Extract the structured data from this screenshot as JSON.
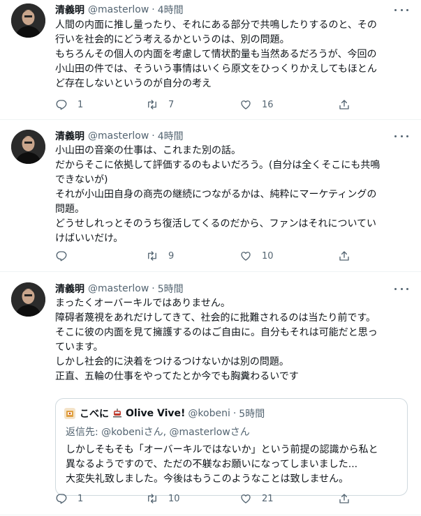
{
  "tweets": [
    {
      "name": "清義明",
      "handle": "@masterlow",
      "dot": "·",
      "time": "4時間",
      "lines": [
        "人間の内面に推し量ったり、それにある部分で共鳴したりするのと、その",
        "行いを社会的にどう考えるかというのは、別の問題。",
        "もちろんその個人の内面を考慮して情状酌量も当然あるだろうが、今回の",
        "小山田の件では、そういう事情はいくら原文をひっくりかえしてもほとん",
        "ど存在しないというのが自分の考え"
      ],
      "replies": "1",
      "retweets": "7",
      "likes": "16"
    },
    {
      "name": "清義明",
      "handle": "@masterlow",
      "dot": "·",
      "time": "4時間",
      "lines": [
        "小山田の音楽の仕事は、これまた別の話。",
        "だからそこに依拠して評価するのもよいだろう。(自分は全くそこにも共鳴",
        "できないが)",
        "それが小山田自身の商売の継続につながるかは、純粋にマーケティングの",
        "問題。",
        "どうせしれっとそのうち復活してくるのだから、ファンはそれについてい",
        "けばいいだけ。"
      ],
      "replies": "",
      "retweets": "9",
      "likes": "10"
    },
    {
      "name": "清義明",
      "handle": "@masterlow",
      "dot": "·",
      "time": "5時間",
      "lines": [
        "まったくオーバーキルではありません。",
        "障碍者蔑視をあれだけしてきて、社会的に批難されるのは当たり前です。",
        "そこに彼の内面を見て擁護するのはご自由に。自分もそれは可能だと思っ",
        "ています。",
        "しかし社会的に決着をつけるつけないかは別の問題。",
        "正直、五輪の仕事をやってたとか今でも胸糞わるいです"
      ],
      "replies": "1",
      "retweets": "10",
      "likes": "21",
      "quote": {
        "name": "こべに",
        "name_suffix": "Olive Vive!",
        "handle": "@kobeni",
        "dot": "·",
        "time": "5時間",
        "reply_to": "返信先: @kobeniさん, @masterlowさん",
        "lines": [
          "しかしそもそも「オーバーキルではないか」という前提の認識から私と",
          "異なるようですので、ただの不躾なお願いになってしまいました...",
          "大変失礼致しました。今後はもうこのようなことは致しません。"
        ]
      }
    }
  ],
  "icons": [
    "reply-icon",
    "retweet-icon",
    "like-icon",
    "share-icon",
    "more-icon"
  ],
  "colors": {
    "text": "#0f1419",
    "secondary": "#536471",
    "divider": "#eff3f4",
    "quote_border": "#cfd9de"
  }
}
